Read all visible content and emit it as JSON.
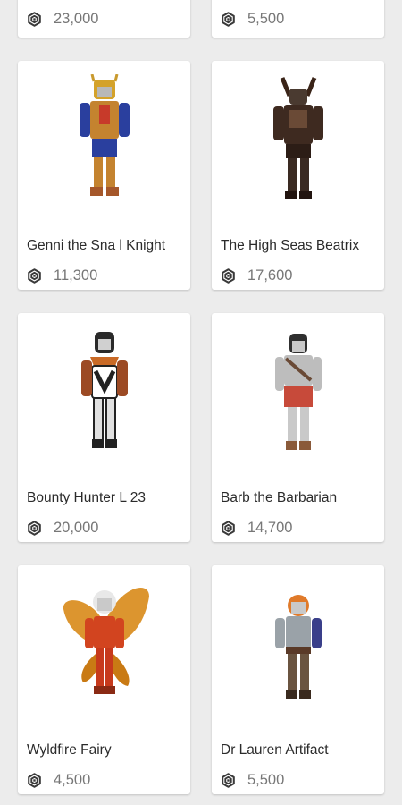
{
  "colors": {
    "background": "#ececec",
    "card": "#ffffff",
    "title_text": "#2b2b2b",
    "price_text": "#777777",
    "robux_icon": "#3a3a3a"
  },
  "icons": {
    "currency": "robux-icon"
  },
  "top_row": [
    {
      "price": "23,000"
    },
    {
      "price": "5,500"
    }
  ],
  "items": [
    {
      "name": "Genni the Sna l Knight",
      "price": "11,300"
    },
    {
      "name": "The High Seas Beatrix",
      "price": "17,600"
    },
    {
      "name": "Bounty Hunter L 23",
      "price": "20,000"
    },
    {
      "name": "Barb the Barbarian",
      "price": "14,700"
    },
    {
      "name": "Wyldfire Fairy",
      "price": "4,500"
    },
    {
      "name": "Dr Lauren Artifact",
      "price": "5,500"
    }
  ]
}
